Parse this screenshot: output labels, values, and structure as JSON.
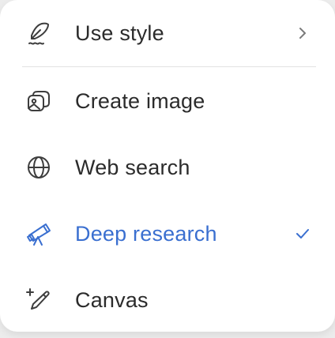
{
  "menu": {
    "items": [
      {
        "label": "Use style",
        "icon": "quill-pen-icon",
        "trailing": "chevron-right-icon"
      },
      {
        "label": "Create image",
        "icon": "image-stack-icon"
      },
      {
        "label": "Web search",
        "icon": "globe-icon"
      },
      {
        "label": "Deep research",
        "icon": "telescope-icon",
        "selected": true,
        "trailing": "checkmark-icon"
      },
      {
        "label": "Canvas",
        "icon": "sparkle-pencil-icon"
      }
    ]
  },
  "colors": {
    "accent": "#3a6fd0",
    "text": "#2b2b2b",
    "icon": "#3d3d3d",
    "background": "#ffffff"
  }
}
